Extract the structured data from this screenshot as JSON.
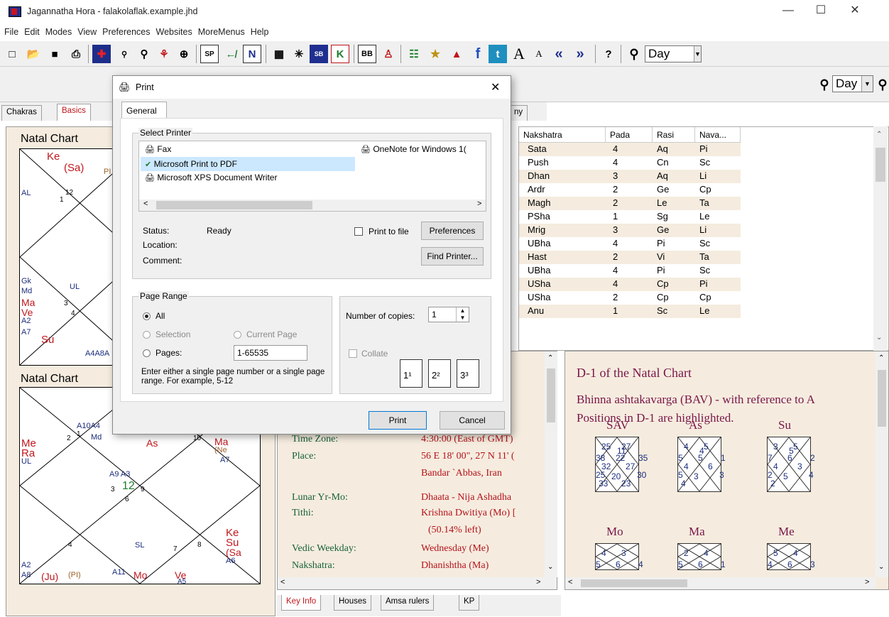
{
  "app": {
    "title": "Jagannatha Hora - falakolaflak.example.jhd"
  },
  "menu": [
    "File",
    "Edit",
    "Modes",
    "View",
    "Preferences",
    "Websites",
    "MoreMenus",
    "Help"
  ],
  "toolbar": {
    "day_label": "Day",
    "day_label2": "Day"
  },
  "tabs_top": [
    "Chakras",
    "Basics"
  ],
  "tabs_top_partial": "ny",
  "left": {
    "chart1_title": "Natal Chart",
    "chart2_title": "Natal Chart",
    "c1": [
      "Ke",
      "(Sa)",
      "PI",
      "AL",
      "12",
      "1",
      "Gk",
      "Md",
      "UL",
      "Ma",
      "Ve",
      "A2",
      "A7",
      "3",
      "4",
      "Su",
      "A4A8A"
    ],
    "c2": [
      "A10A4",
      "HL",
      "1",
      "2",
      "Md",
      "As",
      "10",
      "Ma",
      "(Ne",
      "A7",
      "Me",
      "Ra",
      "UL",
      "A9 A3",
      "12",
      "3",
      "9",
      "6",
      "Ke",
      "Su",
      "(Sa",
      "A6",
      "4",
      "SL",
      "7",
      "8",
      "A2",
      "A8",
      "(Ju)",
      "(PI)",
      "A11",
      "Mo",
      "Ve",
      "A5"
    ]
  },
  "grid": {
    "headers": [
      "Nakshatra",
      "Pada",
      "Rasi",
      "Nava..."
    ],
    "rows": [
      [
        "Sata",
        "4",
        "Aq",
        "Pi"
      ],
      [
        "Push",
        "4",
        "Cn",
        "Sc"
      ],
      [
        "Dhan",
        "3",
        "Aq",
        "Li"
      ],
      [
        "Ardr",
        "2",
        "Ge",
        "Cp"
      ],
      [
        "Magh",
        "2",
        "Le",
        "Ta"
      ],
      [
        "PSha",
        "1",
        "Sg",
        "Le"
      ],
      [
        "Mrig",
        "3",
        "Ge",
        "Li"
      ],
      [
        "UBha",
        "4",
        "Pi",
        "Sc"
      ],
      [
        "Hast",
        "2",
        "Vi",
        "Ta"
      ],
      [
        "UBha",
        "4",
        "Pi",
        "Sc"
      ],
      [
        "USha",
        "4",
        "Cp",
        "Pi"
      ],
      [
        "USha",
        "2",
        "Cp",
        "Cp"
      ],
      [
        "Anu",
        "1",
        "Sc",
        "Le"
      ]
    ]
  },
  "keyinfo": {
    "tz_key": "Time Zone:",
    "tz_val": "4:30:00 (East of GMT)",
    "place_key": "Place:",
    "place_val": "56 E 18' 00\", 27 N 11' (",
    "place_val2": "Bandar `Abbas, Iran",
    "lunar_key": "Lunar Yr-Mo:",
    "lunar_val": "Dhaata - Nija Ashadha",
    "tithi_key": "Tithi:",
    "tithi_val": "Krishna Dwitiya (Mo) [",
    "tithi_val2": "(50.14% left)",
    "week_key": "Vedic Weekday:",
    "week_val": "Wednesday (Me)",
    "naks_key": "Nakshatra:",
    "naks_val": "Dhanishtha (Ma)"
  },
  "right": {
    "heading": "D-1 of the Natal Chart",
    "line1": "Bhinna ashtakavarga (BAV) - with reference to A",
    "line2": "Positions in D-1 are highlighted.",
    "charts": [
      {
        "label": "SAV",
        "nums": [
          "25",
          "27",
          "38",
          "35",
          "22",
          "11",
          "32",
          "27",
          "25",
          "30",
          "20",
          "33",
          "23"
        ]
      },
      {
        "label": "As",
        "nums": [
          "4",
          "5",
          "5",
          "1",
          "5",
          "4",
          "4",
          "6",
          "5",
          "3",
          "3",
          "4"
        ]
      },
      {
        "label": "Su",
        "nums": [
          "3",
          "5",
          "7",
          "2",
          "6",
          "5",
          "4",
          "3",
          "2",
          "4",
          "5",
          "2"
        ]
      },
      {
        "label": "Mo",
        "nums": [
          "4",
          "3",
          "5",
          "4",
          "6"
        ]
      },
      {
        "label": "Ma",
        "nums": [
          "2",
          "4",
          "5",
          "1",
          "6"
        ]
      },
      {
        "label": "Me",
        "nums": [
          "5",
          "4",
          "4",
          "3",
          "6"
        ]
      }
    ]
  },
  "tabs_bottom": [
    "Key Info",
    "Houses",
    "Amsa rulers",
    "KP"
  ],
  "dialog": {
    "title": "Print",
    "tab": "General",
    "select_printer": "Select Printer",
    "printers": [
      "Fax",
      "Microsoft Print to PDF",
      "Microsoft XPS Document Writer",
      "OneNote for Windows 1("
    ],
    "status_label": "Status:",
    "status_value": "Ready",
    "location_label": "Location:",
    "comment_label": "Comment:",
    "print_to_file": "Print to file",
    "preferences": "Preferences",
    "find_printer": "Find Printer...",
    "page_range": "Page Range",
    "all": "All",
    "selection": "Selection",
    "current_page": "Current Page",
    "pages": "Pages:",
    "pages_value": "1-65535",
    "hint": "Enter either a single page number or a single page range.  For example, 5-12",
    "copies_label": "Number of copies:",
    "copies_value": "1",
    "collate": "Collate",
    "print_btn": "Print",
    "cancel_btn": "Cancel"
  }
}
